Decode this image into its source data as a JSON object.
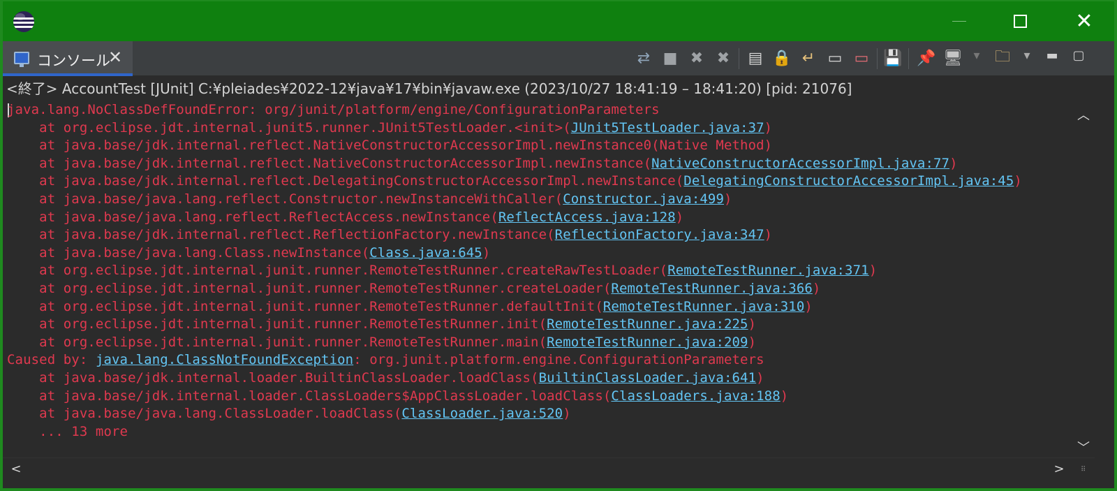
{
  "titlebar": {
    "minimize_label": "—",
    "maximize_label": "",
    "close_label": "✕"
  },
  "tab": {
    "label": "コンソール",
    "close_label": "✕"
  },
  "toolbar_icons": [
    "sync-icon",
    "stop-icon",
    "remove-launch-icon",
    "remove-all-icon",
    "clear-console-icon",
    "scroll-lock-icon",
    "word-wrap-icon",
    "show-on-stdout-icon",
    "show-on-stderr-icon",
    "save-icon",
    "pin-console-icon",
    "display-console-icon",
    "open-console-icon"
  ],
  "status": "<終了> AccountTest [JUnit] C:¥pleiades¥2022-12¥java¥17¥bin¥javaw.exe  (2023/10/27 18:41:19 – 18:41:20) [pid: 21076]",
  "console_lines": [
    {
      "indent": false,
      "text": "java.lang.NoClassDefFoundError: org/junit/platform/engine/ConfigurationParameters",
      "link": "",
      "tail": ""
    },
    {
      "indent": true,
      "text": "at org.eclipse.jdt.internal.junit5.runner.JUnit5TestLoader.<init>(",
      "link": "JUnit5TestLoader.java:37",
      "tail": ")"
    },
    {
      "indent": true,
      "text": "at java.base/jdk.internal.reflect.NativeConstructorAccessorImpl.newInstance0(Native Method)",
      "link": "",
      "tail": ""
    },
    {
      "indent": true,
      "text": "at java.base/jdk.internal.reflect.NativeConstructorAccessorImpl.newInstance(",
      "link": "NativeConstructorAccessorImpl.java:77",
      "tail": ")"
    },
    {
      "indent": true,
      "text": "at java.base/jdk.internal.reflect.DelegatingConstructorAccessorImpl.newInstance(",
      "link": "DelegatingConstructorAccessorImpl.java:45",
      "tail": ")"
    },
    {
      "indent": true,
      "text": "at java.base/java.lang.reflect.Constructor.newInstanceWithCaller(",
      "link": "Constructor.java:499",
      "tail": ")"
    },
    {
      "indent": true,
      "text": "at java.base/java.lang.reflect.ReflectAccess.newInstance(",
      "link": "ReflectAccess.java:128",
      "tail": ")"
    },
    {
      "indent": true,
      "text": "at java.base/jdk.internal.reflect.ReflectionFactory.newInstance(",
      "link": "ReflectionFactory.java:347",
      "tail": ")"
    },
    {
      "indent": true,
      "text": "at java.base/java.lang.Class.newInstance(",
      "link": "Class.java:645",
      "tail": ")"
    },
    {
      "indent": true,
      "text": "at org.eclipse.jdt.internal.junit.runner.RemoteTestRunner.createRawTestLoader(",
      "link": "RemoteTestRunner.java:371",
      "tail": ")"
    },
    {
      "indent": true,
      "text": "at org.eclipse.jdt.internal.junit.runner.RemoteTestRunner.createLoader(",
      "link": "RemoteTestRunner.java:366",
      "tail": ")"
    },
    {
      "indent": true,
      "text": "at org.eclipse.jdt.internal.junit.runner.RemoteTestRunner.defaultInit(",
      "link": "RemoteTestRunner.java:310",
      "tail": ")"
    },
    {
      "indent": true,
      "text": "at org.eclipse.jdt.internal.junit.runner.RemoteTestRunner.init(",
      "link": "RemoteTestRunner.java:225",
      "tail": ")"
    },
    {
      "indent": true,
      "text": "at org.eclipse.jdt.internal.junit.runner.RemoteTestRunner.main(",
      "link": "RemoteTestRunner.java:209",
      "tail": ")"
    },
    {
      "indent": false,
      "text": "Caused by: ",
      "link": "java.lang.ClassNotFoundException",
      "tail": ": org.junit.platform.engine.ConfigurationParameters"
    },
    {
      "indent": true,
      "text": "at java.base/jdk.internal.loader.BuiltinClassLoader.loadClass(",
      "link": "BuiltinClassLoader.java:641",
      "tail": ")"
    },
    {
      "indent": true,
      "text": "at java.base/jdk.internal.loader.ClassLoaders$AppClassLoader.loadClass(",
      "link": "ClassLoaders.java:188",
      "tail": ")"
    },
    {
      "indent": true,
      "text": "at java.base/java.lang.ClassLoader.loadClass(",
      "link": "ClassLoader.java:520",
      "tail": ")"
    },
    {
      "indent": true,
      "text": "... 13 more",
      "link": "",
      "tail": ""
    }
  ],
  "scroll": {
    "up": "︿",
    "down": "﹀",
    "left": "<",
    "right": ">"
  },
  "colors": {
    "titlebar": "#0f800f",
    "error_text": "#e0394f",
    "link_text": "#63c5f4",
    "tab_accent": "#2f65ca",
    "background": "#2b2b2b"
  }
}
